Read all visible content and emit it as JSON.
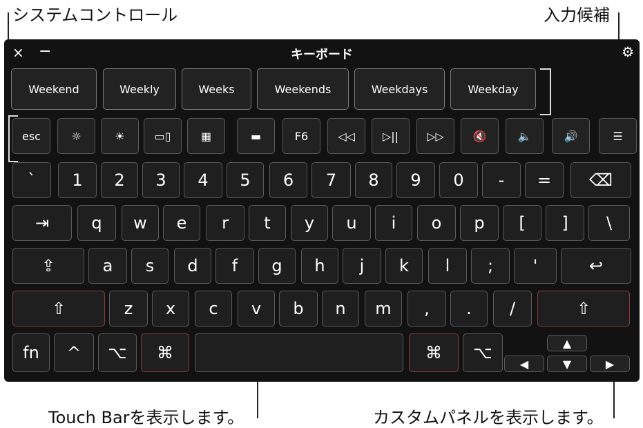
{
  "callouts": {
    "system_control": "システムコントロール",
    "candidates": "入力候補",
    "touch_bar": "Touch Barを表示します。",
    "custom_panel": "カスタムパネルを表示します。"
  },
  "window": {
    "title": "キーボード",
    "close_glyph": "×",
    "minimize_glyph": "−",
    "settings_glyph": "⚙"
  },
  "candidates": [
    "Weekend",
    "Weekly",
    "Weeks",
    "Weekends",
    "Weekdays",
    "Weekday"
  ],
  "function_row": [
    "esc",
    "☼",
    "☀",
    "▭▯",
    "▦",
    "▬",
    "F6",
    "◁◁",
    "▷||",
    "▷▷",
    "🔇",
    "🔈",
    "🔊",
    "☰"
  ],
  "rows": {
    "numbers": [
      "`",
      "1",
      "2",
      "3",
      "4",
      "5",
      "6",
      "7",
      "8",
      "9",
      "0",
      "-",
      "=",
      "⌫"
    ],
    "top": [
      "⇥",
      "q",
      "w",
      "e",
      "r",
      "t",
      "y",
      "u",
      "i",
      "o",
      "p",
      "[",
      "]",
      "\\"
    ],
    "home": [
      "⇪",
      "a",
      "s",
      "d",
      "f",
      "g",
      "h",
      "j",
      "k",
      "l",
      ";",
      "'",
      "↩"
    ],
    "bottom": [
      "⇧",
      "z",
      "x",
      "c",
      "v",
      "b",
      "n",
      "m",
      ",",
      ".",
      "/",
      "⇧"
    ],
    "modifiers": [
      "fn",
      "^",
      "⌥",
      "⌘",
      "",
      "⌘",
      "⌥"
    ]
  },
  "arrows": {
    "up": "▲",
    "left": "◀",
    "down": "▼",
    "right": "▶"
  }
}
